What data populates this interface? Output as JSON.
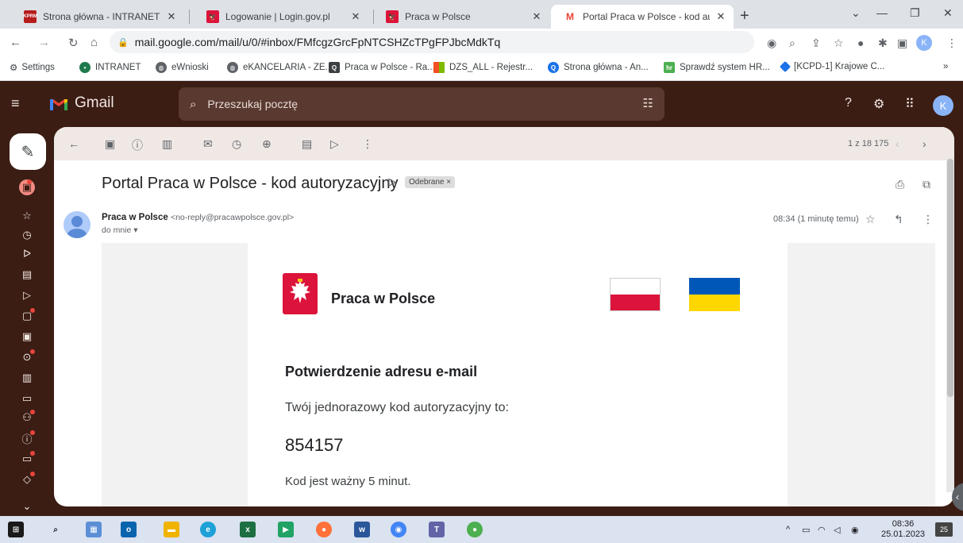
{
  "browser": {
    "tabs": [
      {
        "title": "Strona główna - INTRANET KPRM",
        "close": "✕",
        "active": false
      },
      {
        "title": "Logowanie | Login.gov.pl",
        "close": "✕",
        "active": false
      },
      {
        "title": "Praca w Polsce",
        "close": "✕",
        "active": false
      },
      {
        "title": "Portal Praca w Polsce - kod autor",
        "close": "✕",
        "active": true
      }
    ],
    "new_tab": "+",
    "url": "mail.google.com/mail/u/0/#inbox/FMfcgzGrcFpNTCSHZcTPgFPJbcMdkTq",
    "profile_initial": "K",
    "bookmarks": [
      {
        "label": "Settings"
      },
      {
        "label": "INTRANET"
      },
      {
        "label": "eWnioski"
      },
      {
        "label": "eKANCELARIA - ZE..."
      },
      {
        "label": "Praca w Polsce - Ra..."
      },
      {
        "label": "DZS_ALL - Rejestr..."
      },
      {
        "label": "Strona główna - An..."
      },
      {
        "label": "Sprawdź system HR..."
      },
      {
        "label": "[KCPD-1] Krajowe C..."
      }
    ]
  },
  "gmail": {
    "app_name": "Gmail",
    "search_placeholder": "Przeszukaj pocztę",
    "account_initial": "K",
    "counter": "1 z 18 175",
    "message": {
      "subject": "Portal Praca w Polsce - kod autoryzacyjny",
      "label": "Odebrane ×",
      "sender_name": "Praca w Polsce",
      "sender_email": "<no-reply@pracawpolsce.gov.pl>",
      "to": "do mnie ▾",
      "time": "08:34 (1 minutę temu)"
    },
    "email_body": {
      "brand": "Praca w Polsce",
      "heading": "Potwierdzenie adresu e-mail",
      "intro": "Twój jednorazowy kod autoryzacyjny to:",
      "code": "854157",
      "validity": "Kod jest ważny 5 minut."
    }
  },
  "taskbar": {
    "time": "08:36",
    "date": "25.01.2023",
    "notifications": "25"
  }
}
